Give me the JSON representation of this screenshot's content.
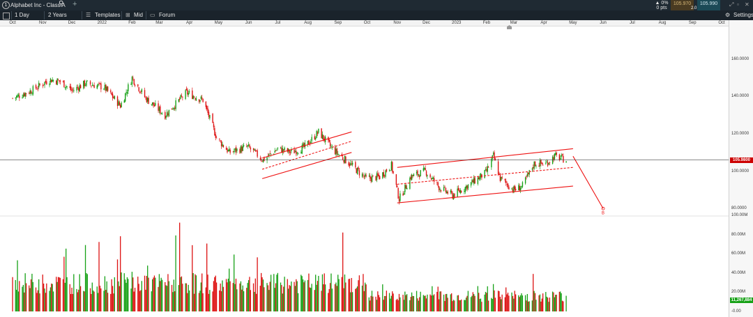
{
  "header": {
    "symbol_title": "Alphabet Inc - Class A",
    "change_percent": "▲ 0%",
    "change_points": "0 pts",
    "bid": "105.970",
    "ask": "105.990",
    "spread": "2.0",
    "colors": {
      "bar": "#1f2a33",
      "bid_bg": "#4a3b22",
      "ask_bg": "#1c4a57"
    }
  },
  "toolbar": {
    "interval": "1 Day",
    "range": "2 Years",
    "templates": "Templates",
    "mid": "Mid",
    "forum": "Forum",
    "settings": "Settings"
  },
  "time_axis": {
    "months": [
      "Oct",
      "Nov",
      "Dec",
      "2022",
      "Feb",
      "Mar",
      "Apr",
      "May",
      "Jun",
      "Jul",
      "Aug",
      "Sep",
      "Oct",
      "Nov",
      "Dec",
      "2023",
      "Feb",
      "Mar",
      "Apr",
      "May",
      "Jun",
      "Jul",
      "Aug",
      "Sep",
      "Oct"
    ]
  },
  "price_axis": {
    "labels": [
      "160.0000",
      "140.0000",
      "120.0000",
      "100.0000",
      "80.0000"
    ],
    "current_price": "105.9800",
    "current_price_color": "#cc0000"
  },
  "volume_axis": {
    "labels": [
      "100.00M",
      "80.00M",
      "60.00M",
      "40.00M",
      "20.00M",
      "-0.00"
    ],
    "current_volume": "11,267,884",
    "current_volume_color": "#16a116"
  },
  "chart_data": {
    "type": "candlestick",
    "instrument": "Alphabet Inc - Class A",
    "interval": "1 Day",
    "range": "2 Years",
    "price_ylim": [
      76,
      164
    ],
    "volume_ylim": [
      0,
      100000000
    ],
    "last_price": 105.98,
    "last_volume": 11267884,
    "grid": false,
    "colors": {
      "up": "#16a116",
      "down": "#dd1111",
      "trend": "#ee1111"
    },
    "close_path": [
      [
        "2021-10-01",
        139
      ],
      [
        "2021-10-20",
        143
      ],
      [
        "2021-11-08",
        149
      ],
      [
        "2021-11-20",
        148
      ],
      [
        "2021-12-01",
        143
      ],
      [
        "2021-12-15",
        147
      ],
      [
        "2022-01-03",
        145
      ],
      [
        "2022-01-20",
        135
      ],
      [
        "2022-02-01",
        150
      ],
      [
        "2022-02-15",
        139
      ],
      [
        "2022-03-07",
        130
      ],
      [
        "2022-03-29",
        142
      ],
      [
        "2022-04-15",
        138
      ],
      [
        "2022-04-29",
        118
      ],
      [
        "2022-05-12",
        110
      ],
      [
        "2022-05-31",
        113
      ],
      [
        "2022-06-16",
        106
      ],
      [
        "2022-07-01",
        112
      ],
      [
        "2022-07-15",
        110
      ],
      [
        "2022-07-29",
        113
      ],
      [
        "2022-08-12",
        121
      ],
      [
        "2022-08-26",
        112
      ],
      [
        "2022-09-13",
        104
      ],
      [
        "2022-09-30",
        96
      ],
      [
        "2022-10-14",
        97
      ],
      [
        "2022-10-26",
        103
      ],
      [
        "2022-11-03",
        85
      ],
      [
        "2022-11-15",
        97
      ],
      [
        "2022-11-30",
        100
      ],
      [
        "2022-12-15",
        91
      ],
      [
        "2022-12-28",
        87
      ],
      [
        "2023-01-12",
        92
      ],
      [
        "2023-01-31",
        99
      ],
      [
        "2023-02-08",
        108
      ],
      [
        "2023-02-15",
        96
      ],
      [
        "2023-03-01",
        90
      ],
      [
        "2023-03-10",
        92
      ],
      [
        "2023-03-22",
        104
      ],
      [
        "2023-04-03",
        104
      ],
      [
        "2023-04-12",
        108
      ],
      [
        "2023-04-24",
        106
      ]
    ],
    "trend_lines": [
      {
        "style": "solid",
        "from": [
          "2022-06-15",
          107
        ],
        "to": [
          "2022-09-15",
          121
        ]
      },
      {
        "style": "solid",
        "from": [
          "2022-06-15",
          96
        ],
        "to": [
          "2022-09-15",
          110
        ]
      },
      {
        "style": "dashed",
        "from": [
          "2022-06-15",
          101
        ],
        "to": [
          "2022-09-15",
          116
        ]
      },
      {
        "style": "solid",
        "from": [
          "2022-11-01",
          102
        ],
        "to": [
          "2023-05-01",
          112
        ]
      },
      {
        "style": "solid",
        "from": [
          "2022-11-01",
          83
        ],
        "to": [
          "2023-05-01",
          92
        ]
      },
      {
        "style": "dashed",
        "from": [
          "2022-11-01",
          93
        ],
        "to": [
          "2023-05-01",
          102
        ]
      },
      {
        "style": "solid",
        "from": [
          "2023-05-01",
          108
        ],
        "to": [
          "2023-06-01",
          80
        ]
      }
    ],
    "target_marker": {
      "label": "B",
      "date": "2023-06-01",
      "value": 80
    }
  }
}
